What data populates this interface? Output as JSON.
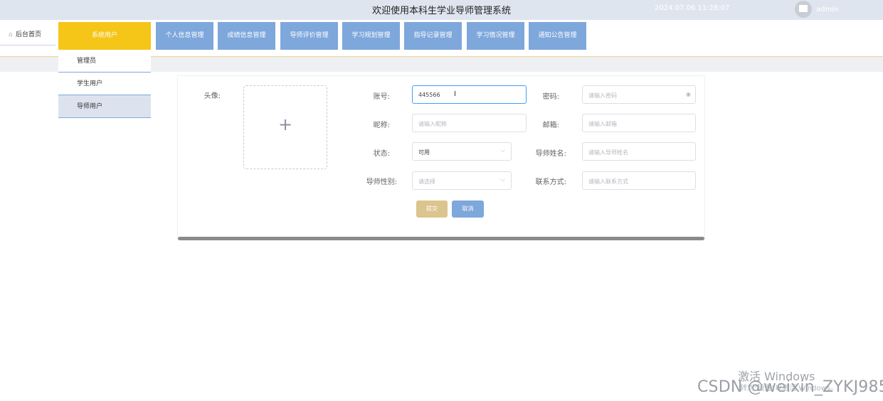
{
  "header": {
    "title": "欢迎使用本科生学业导师管理系统",
    "datetime": "2024.07.06 11:28:07",
    "user": "admin",
    "avatar_icon": "image-icon"
  },
  "home": {
    "label": "后台首页",
    "icon": "home-icon"
  },
  "menu": [
    {
      "label": "系统用户",
      "active": true
    },
    {
      "label": "个人信息管理"
    },
    {
      "label": "成绩信息管理"
    },
    {
      "label": "导师评价管理"
    },
    {
      "label": "学习规划管理"
    },
    {
      "label": "指导记录管理"
    },
    {
      "label": "学习情况管理"
    },
    {
      "label": "通知公告管理"
    }
  ],
  "dropdown": [
    {
      "label": "管理员"
    },
    {
      "label": "学生用户"
    },
    {
      "label": "导师用户",
      "selected": true
    }
  ],
  "form": {
    "avatar_label": "头像:",
    "upload_icon": "+",
    "account": {
      "label": "账号:",
      "value": "445566"
    },
    "password": {
      "label": "密码:",
      "placeholder": "请输入密码"
    },
    "nickname": {
      "label": "昵称:",
      "placeholder": "请输入昵称"
    },
    "email": {
      "label": "邮箱:",
      "placeholder": "请输入邮箱"
    },
    "status": {
      "label": "状态:",
      "value": "可用"
    },
    "tutor_name": {
      "label": "导师姓名:",
      "placeholder": "请输入导师姓名"
    },
    "tutor_gender": {
      "label": "导师性别:",
      "placeholder": "请选择"
    },
    "contact": {
      "label": "联系方式:",
      "placeholder": "请输入联系方式"
    },
    "submit_label": "提交",
    "cancel_label": "取消"
  },
  "colors": {
    "menu": "#7ea7db",
    "menu_active": "#f5c518",
    "submit": "#dcc48e",
    "cancel": "#7ea7db"
  },
  "overlay": {
    "windows_activate": "激活 Windows",
    "windows_sub": "转到\"设置\"以激活 Windows。",
    "csdn": "CSDN @weixin_ZYKJ985"
  }
}
